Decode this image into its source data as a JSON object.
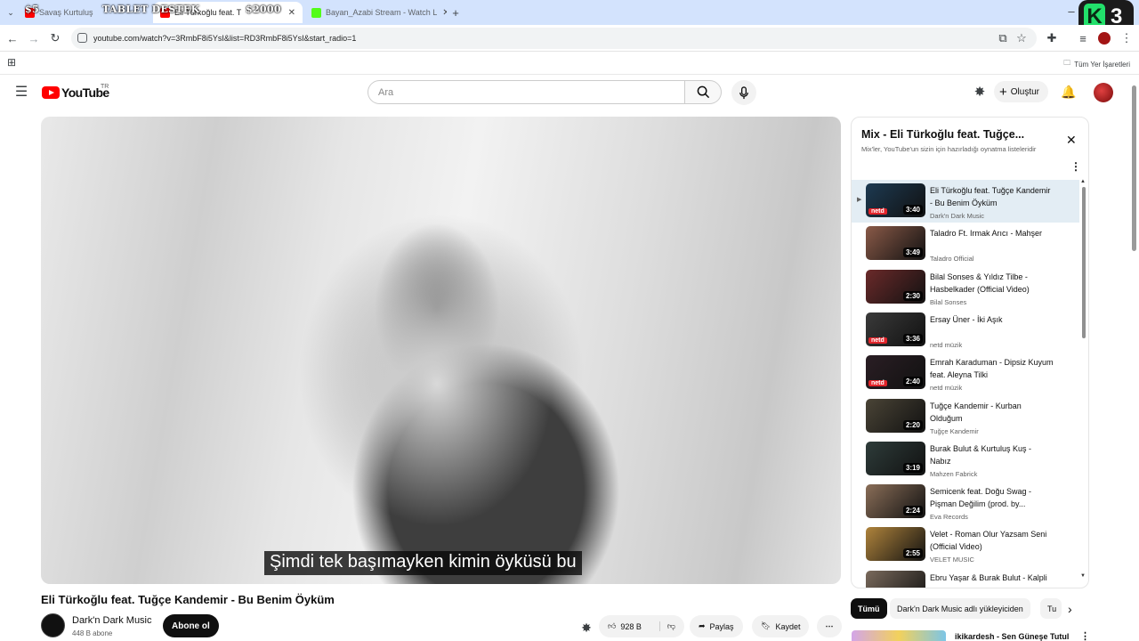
{
  "browser": {
    "tabs": [
      {
        "label": "Savaş Kurtuluş"
      },
      {
        "label": "Eli Türkoğlu feat. T"
      },
      {
        "label": "Bayan_Azabi Stream - Watch L"
      }
    ],
    "overlay_left": "$5",
    "overlay_center": "TABLET DESTEK",
    "overlay_right": "$2000",
    "badge_letter": "K",
    "badge_number": "3",
    "url": "youtube.com/watch?v=3RmbF8i5YsI&list=RD3RmbF8i5YsI&start_radio=1",
    "bookmarks_all": "Tüm Yer İşaretleri"
  },
  "masthead": {
    "logo_text": "YouTube",
    "country": "TR",
    "search_placeholder": "Ara",
    "create_label": "Oluştur"
  },
  "video": {
    "subtitle": "Şimdi tek başımayken kimin öyküsü bu",
    "title": "Eli Türkoğlu feat. Tuğçe Kandemir - Bu Benim Öyküm",
    "channel": "Dark'n Dark Music",
    "subscribers": "448 B abone",
    "subscribe_label": "Abone ol",
    "likes": "928 B",
    "share_label": "Paylaş",
    "save_label": "Kaydet"
  },
  "playlist": {
    "title": "Mix - Eli Türkoğlu feat. Tuğçe...",
    "subtitle": "Mix'ler, YouTube'un sizin için hazırladığı oynatma listeleridir",
    "items": [
      {
        "title": "Eli Türkoğlu feat. Tuğçe Kandemir - Bu Benim Öyküm",
        "channel": "Dark'n Dark Music",
        "duration": "3:40",
        "thumb": "#1d3a52",
        "netd": "netd"
      },
      {
        "title": "Taladro Ft. Irmak Arıcı - Mahşer",
        "channel": "Taladro Official",
        "duration": "3:49",
        "thumb": "#8a5a48",
        "netd": ""
      },
      {
        "title": "Bilal Sonses & Yıldız Tilbe - Hasbelkader (Official Video)",
        "channel": "Bilal Sonses",
        "duration": "2:30",
        "thumb": "#6b2a2a",
        "netd": ""
      },
      {
        "title": "Ersay Üner - İki Aşık",
        "channel": "netd müzik",
        "duration": "3:36",
        "thumb": "#3a3a3a",
        "netd": "netd"
      },
      {
        "title": "Emrah Karaduman - Dipsiz Kuyum feat. Aleyna Tilki",
        "channel": "netd müzik",
        "duration": "2:40",
        "thumb": "#2a1e24",
        "netd": "netd"
      },
      {
        "title": "Tuğçe Kandemir - Kurban Olduğum",
        "channel": "Tuğçe Kandemir",
        "duration": "2:20",
        "thumb": "#4a4436",
        "netd": ""
      },
      {
        "title": "Burak Bulut & Kurtuluş Kuş - Nabız",
        "channel": "Mahzen Fabrick",
        "duration": "3:19",
        "thumb": "#2e3c3a",
        "netd": ""
      },
      {
        "title": "Semicenk feat. Doğu Swag - Pişman Değilim (prod. by...",
        "channel": "Eva Records",
        "duration": "2:24",
        "thumb": "#8a6e58",
        "netd": ""
      },
      {
        "title": "Velet - Roman Olur Yazsam Seni (Official Video)",
        "channel": "VELET MUSIC",
        "duration": "2:55",
        "thumb": "#b0843c",
        "netd": ""
      },
      {
        "title": "Ebru Yaşar & Burak Bulut - Kalpli",
        "channel": "",
        "duration": "",
        "thumb": "#7a6a5c",
        "netd": ""
      }
    ]
  },
  "chips": [
    {
      "label": "Tümü"
    },
    {
      "label": "Dark'n Dark Music adlı yükleyiciden"
    },
    {
      "label": "Tu"
    }
  ],
  "next_video": {
    "title": "ikikardesh - Sen Güneşe Tutul"
  }
}
